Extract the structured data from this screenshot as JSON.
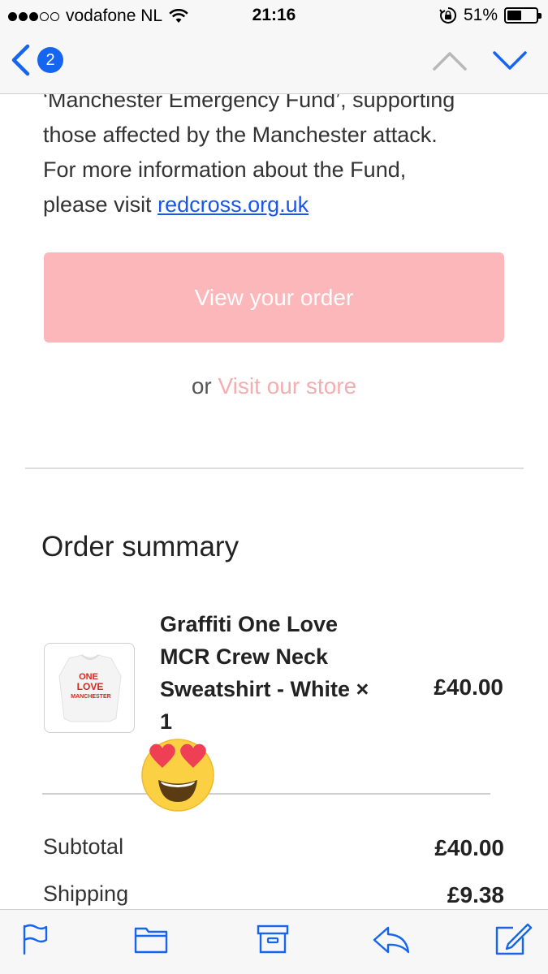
{
  "status_bar": {
    "carrier": "vodafone NL",
    "time": "21:16",
    "battery_percent": "51%",
    "battery_level": 0.51
  },
  "nav": {
    "unread_count": "2",
    "accent_color": "#1565f0"
  },
  "email": {
    "body_line1": "‘Manchester Emergency Fund’, supporting",
    "body_line2": "those affected by the Manchester attack.",
    "body_line3": "For more information about the Fund,",
    "body_line4_prefix": "please visit ",
    "link_text": "redcross.org.uk",
    "view_order_label": "View your order",
    "or_text": "or ",
    "visit_store_label": "Visit our store",
    "button_color": "#fbb7b9"
  },
  "order_summary": {
    "title": "Order summary",
    "items": [
      {
        "name": "Graffiti One Love MCR Crew Neck Sweatshirt - White × 1",
        "price": "£40.00",
        "image_text": [
          "ONE",
          "LOVE",
          "MANCHESTER"
        ]
      }
    ],
    "subtotal_label": "Subtotal",
    "subtotal_value": "£40.00",
    "shipping_label": "Shipping",
    "shipping_value": "£9.38"
  },
  "overlay": {
    "emoji": "heart-eyes-emoji"
  },
  "toolbar": {
    "icons": [
      "flag-icon",
      "folder-icon",
      "archive-icon",
      "reply-icon",
      "compose-icon"
    ],
    "accent_color": "#1565f0"
  }
}
